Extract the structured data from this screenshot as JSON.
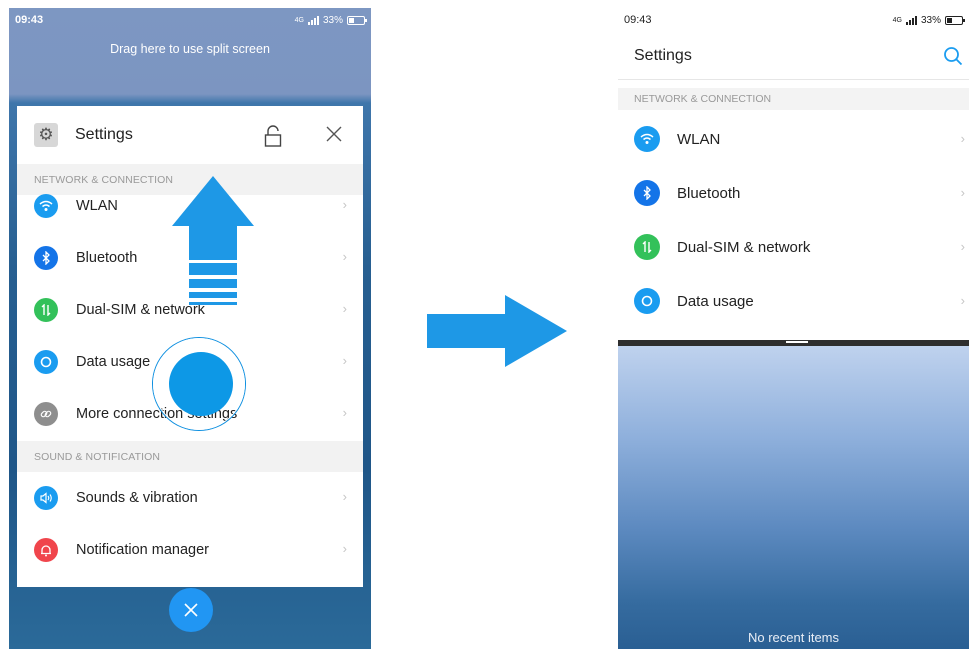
{
  "left_screen": {
    "status": {
      "time": "09:43",
      "network": "4G",
      "battery": "33%"
    },
    "drag_hint": "Drag here to use split screen",
    "card": {
      "title": "Settings",
      "sections": [
        {
          "header": "NETWORK & CONNECTION",
          "items": [
            {
              "label": "WLAN",
              "icon": "wifi-icon",
              "color": "#1a9cf0"
            },
            {
              "label": "Bluetooth",
              "icon": "bluetooth-icon",
              "color": "#1474e8"
            },
            {
              "label": "Dual-SIM & network",
              "icon": "dual-sim-icon",
              "color": "#33c15a"
            },
            {
              "label": "Data usage",
              "icon": "data-usage-icon",
              "color": "#1a9cf0"
            },
            {
              "label": "More connection settings",
              "icon": "link-icon",
              "color": "#8e8e8e"
            }
          ]
        },
        {
          "header": "SOUND & NOTIFICATION",
          "items": [
            {
              "label": "Sounds & vibration",
              "icon": "speaker-icon",
              "color": "#1a9cf0"
            },
            {
              "label": "Notification manager",
              "icon": "bell-icon",
              "color": "#f0454c"
            }
          ]
        }
      ]
    }
  },
  "right_screen": {
    "status": {
      "time": "09:43",
      "network": "4G",
      "battery": "33%"
    },
    "title": "Settings",
    "section_header": "NETWORK & CONNECTION",
    "items": [
      {
        "label": "WLAN",
        "icon": "wifi-icon",
        "color": "#1a9cf0"
      },
      {
        "label": "Bluetooth",
        "icon": "bluetooth-icon",
        "color": "#1474e8"
      },
      {
        "label": "Dual-SIM & network",
        "icon": "dual-sim-icon",
        "color": "#33c15a"
      },
      {
        "label": "Data usage",
        "icon": "data-usage-icon",
        "color": "#1a9cf0"
      }
    ],
    "recents_text": "No recent items"
  },
  "colors": {
    "accent": "#2196f3",
    "gesture_blue": "#0d98e6"
  }
}
